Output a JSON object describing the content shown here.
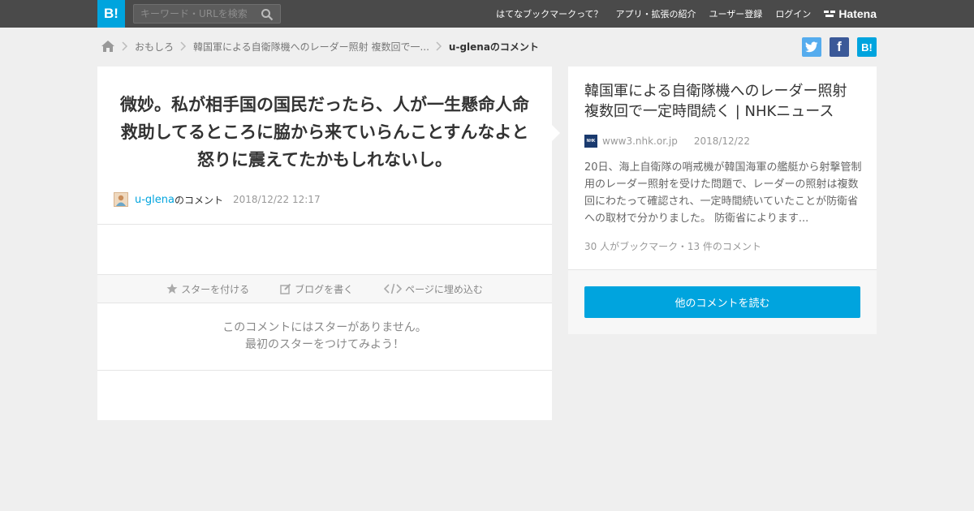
{
  "header": {
    "logo_text": "B!",
    "search_placeholder": "キーワード・URLを検索",
    "nav": [
      "はてなブックマークって？",
      "アプリ・拡張の紹介",
      "ユーザー登録",
      "ログイン"
    ],
    "hatena_label": "Hatena"
  },
  "breadcrumb": {
    "items": [
      "おもしろ",
      "韓国軍による自衛隊機へのレーダー照射 複数回で一...",
      "u-glenaのコメント"
    ]
  },
  "share": {
    "facebook_label": "f",
    "hatena_label": "B!",
    "colors": {
      "twitter": "#55acee",
      "facebook": "#3b5998",
      "hatena": "#00a4de"
    }
  },
  "comment": {
    "text": "微妙。私が相手国の国民だったら、人が一生懸命人命救助してるところに脇から来ていらんことすんなよと怒りに震えてたかもしれないし。",
    "user": "u-glena",
    "user_suffix": "のコメント",
    "date": "2018/12/22 12:17"
  },
  "actions": {
    "star": "スターを付ける",
    "blog": "ブログを書く",
    "embed": "ページに埋め込む"
  },
  "stars": {
    "line1": "このコメントにはスターがありません。",
    "line2": "最初のスターをつけてみよう！"
  },
  "entry": {
    "title": "韓国軍による自衛隊機へのレーダー照射 複数回で一定時間続く | NHKニュース",
    "favicon_text": "NHK",
    "domain": "www3.nhk.or.jp",
    "date": "2018/12/22",
    "description": "20日、海上自衛隊の哨戒機が韓国海軍の艦艇から射撃管制用のレーダー照射を受けた問題で、レーダーの照射は複数回にわたって確認され、一定時間続いていたことが防衛省への取材で分かりました。 防衛省によります...",
    "stats": "30 人がブックマーク・13 件のコメント",
    "read_button": "他のコメントを読む"
  },
  "colors": {
    "accent": "#00a4de",
    "header_bg": "#4a4a4a",
    "page_bg": "#efefef"
  }
}
